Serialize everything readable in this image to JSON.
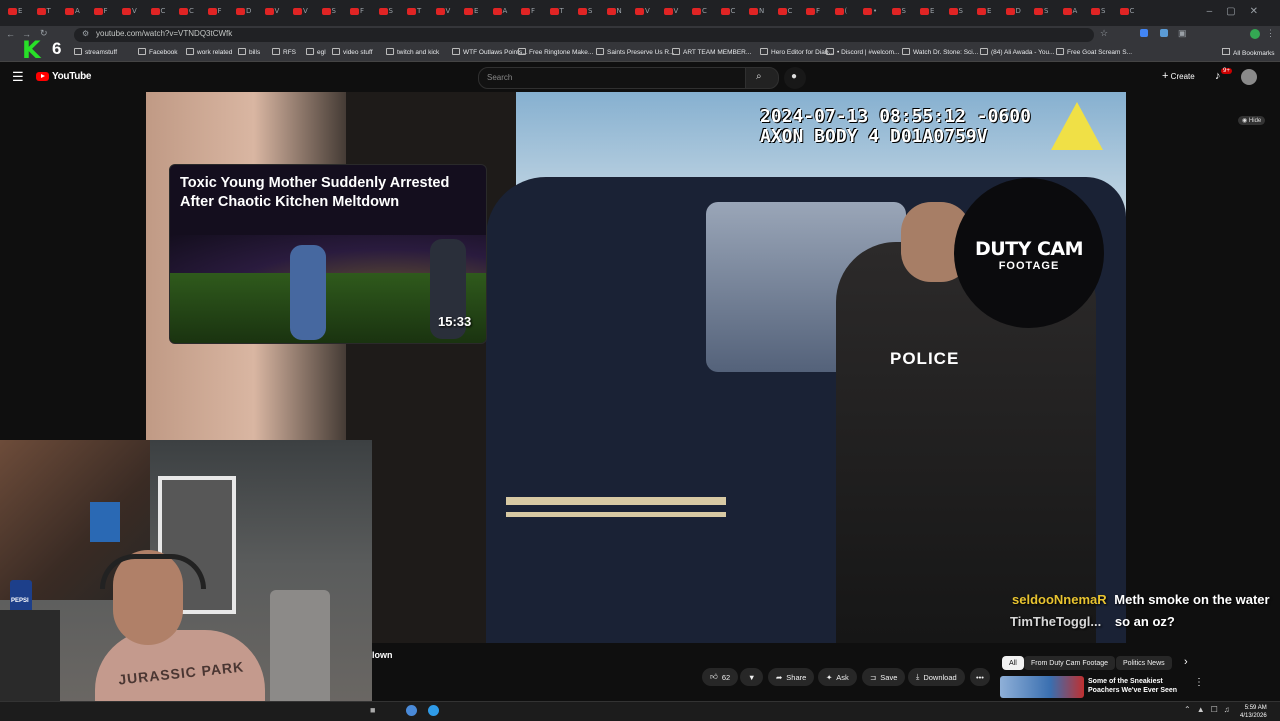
{
  "browser": {
    "tab_letters": [
      "Е",
      "T",
      "A",
      "F",
      "V",
      "C",
      "C",
      "F",
      "D",
      "V",
      "V",
      "S",
      "F",
      "S",
      "T",
      "V",
      "E",
      "A",
      "F",
      "T",
      "S",
      "N",
      "V",
      "V",
      "C",
      "C",
      "N",
      "C",
      "F",
      "(",
      "•",
      "S",
      "E",
      "S",
      "E",
      "D",
      "S",
      "A",
      "S",
      "C"
    ],
    "address_url": "youtube.com/watch?v=VTNDQ3tCWfk",
    "bookmarks": [
      {
        "label": "streamstuff"
      },
      {
        "label": "Facebook"
      },
      {
        "label": "work related"
      },
      {
        "label": "bills"
      },
      {
        "label": "RFS"
      },
      {
        "label": "egl"
      },
      {
        "label": "video stuff"
      },
      {
        "label": "twitch and kick"
      },
      {
        "label": "WTF Outlaws Points..."
      },
      {
        "label": "Free Ringtone Make..."
      },
      {
        "label": "Saints Preserve Us R..."
      },
      {
        "label": "ART TEAM MEMBER..."
      },
      {
        "label": "Hero Editor for Diab..."
      },
      {
        "label": "• Discord | #welcom..."
      },
      {
        "label": "Watch Dr. Stone: Sci..."
      },
      {
        "label": "(84) Ali Awada - You..."
      },
      {
        "label": "Free Goat Scream S..."
      }
    ],
    "all_bookmarks": "All Bookmarks"
  },
  "youtube": {
    "logo_text": "YouTube",
    "search_placeholder": "Search",
    "create_label": "Create",
    "notification_count": "9+"
  },
  "video": {
    "timestamp_line1": "2024-07-13 08:55:12 -0600",
    "timestamp_line2": "AXON BODY 4 D01A0759V",
    "police_text": "POLICE",
    "hide_label": "Hide",
    "end_card": {
      "title": "Toxic Young Mother Suddenly Arrested After Chaotic Kitchen Meltdown",
      "duration": "15:33"
    },
    "channel_watermark": {
      "line1": "DUTY CAM",
      "line2": "FOOTAGE"
    }
  },
  "webcam": {
    "shirt_text": "JURASSIC PARK",
    "can_label": "PEPSI"
  },
  "chat": [
    {
      "user": "seldooNnemaR",
      "message": "Meth smoke on the water",
      "user_color": "#e8c330"
    },
    {
      "user": "TimTheToggl...",
      "message": "so an oz?",
      "user_color": "#d8d8d8"
    }
  ],
  "below_video": {
    "partial_title": "lown",
    "likes": "62",
    "share": "Share",
    "ask": "Ask",
    "save": "Save",
    "download": "Download"
  },
  "sidebar_chips": [
    "All",
    "From Duty Cam Footage",
    "Politics News"
  ],
  "suggested": {
    "title_line1": "Some of the Sneakiest",
    "title_line2": "Poachers We've Ever Seen"
  },
  "streamer_overlay": {
    "number": "6"
  },
  "taskbar": {
    "time": "5:59 AM",
    "date": "4/13/2026"
  },
  "colors": {
    "youtube_red": "#ff0000",
    "accent_yellow": "#e8c330",
    "timestamp_white": "#ffffff"
  }
}
